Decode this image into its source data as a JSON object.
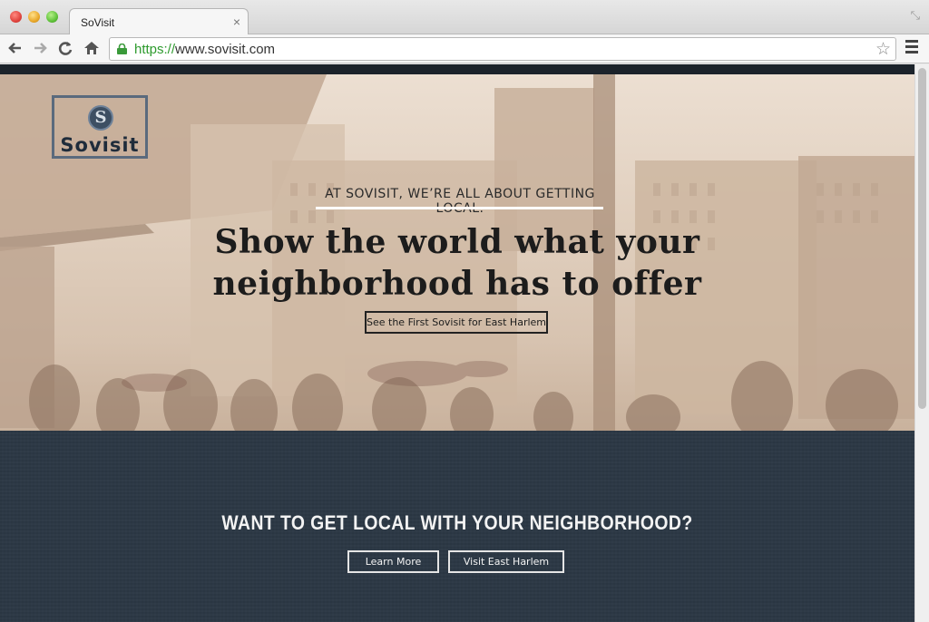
{
  "browser": {
    "tab_title": "SoVisit",
    "tab_close": "×",
    "url_scheme": "https://",
    "url_rest": "www.sovisit.com"
  },
  "icons": {
    "back": "back-arrow-icon",
    "forward": "forward-arrow-icon",
    "reload": "reload-icon",
    "home": "home-icon",
    "lock": "lock-icon",
    "star": "bookmark-star-icon",
    "menu": "menu-icon"
  },
  "hero": {
    "logo_letter": "S",
    "logo_text": "Sovisit",
    "tagline": "AT SOVISIT, WE’RE ALL ABOUT GETTING LOCAL.",
    "headline_line1": "Show the world what your",
    "headline_line2": "neighborhood has to offer",
    "button": "See the First Sovisit for East Harlem"
  },
  "cta": {
    "heading": "WANT TO GET LOCAL WITH YOUR NEIGHBORHOOD?",
    "learn_more": "Learn More",
    "visit": "Visit East Harlem"
  },
  "colors": {
    "hero_tint": "#e1d0bf",
    "cta_bg": "#2c3845",
    "url_scheme": "#2e9b2e"
  }
}
